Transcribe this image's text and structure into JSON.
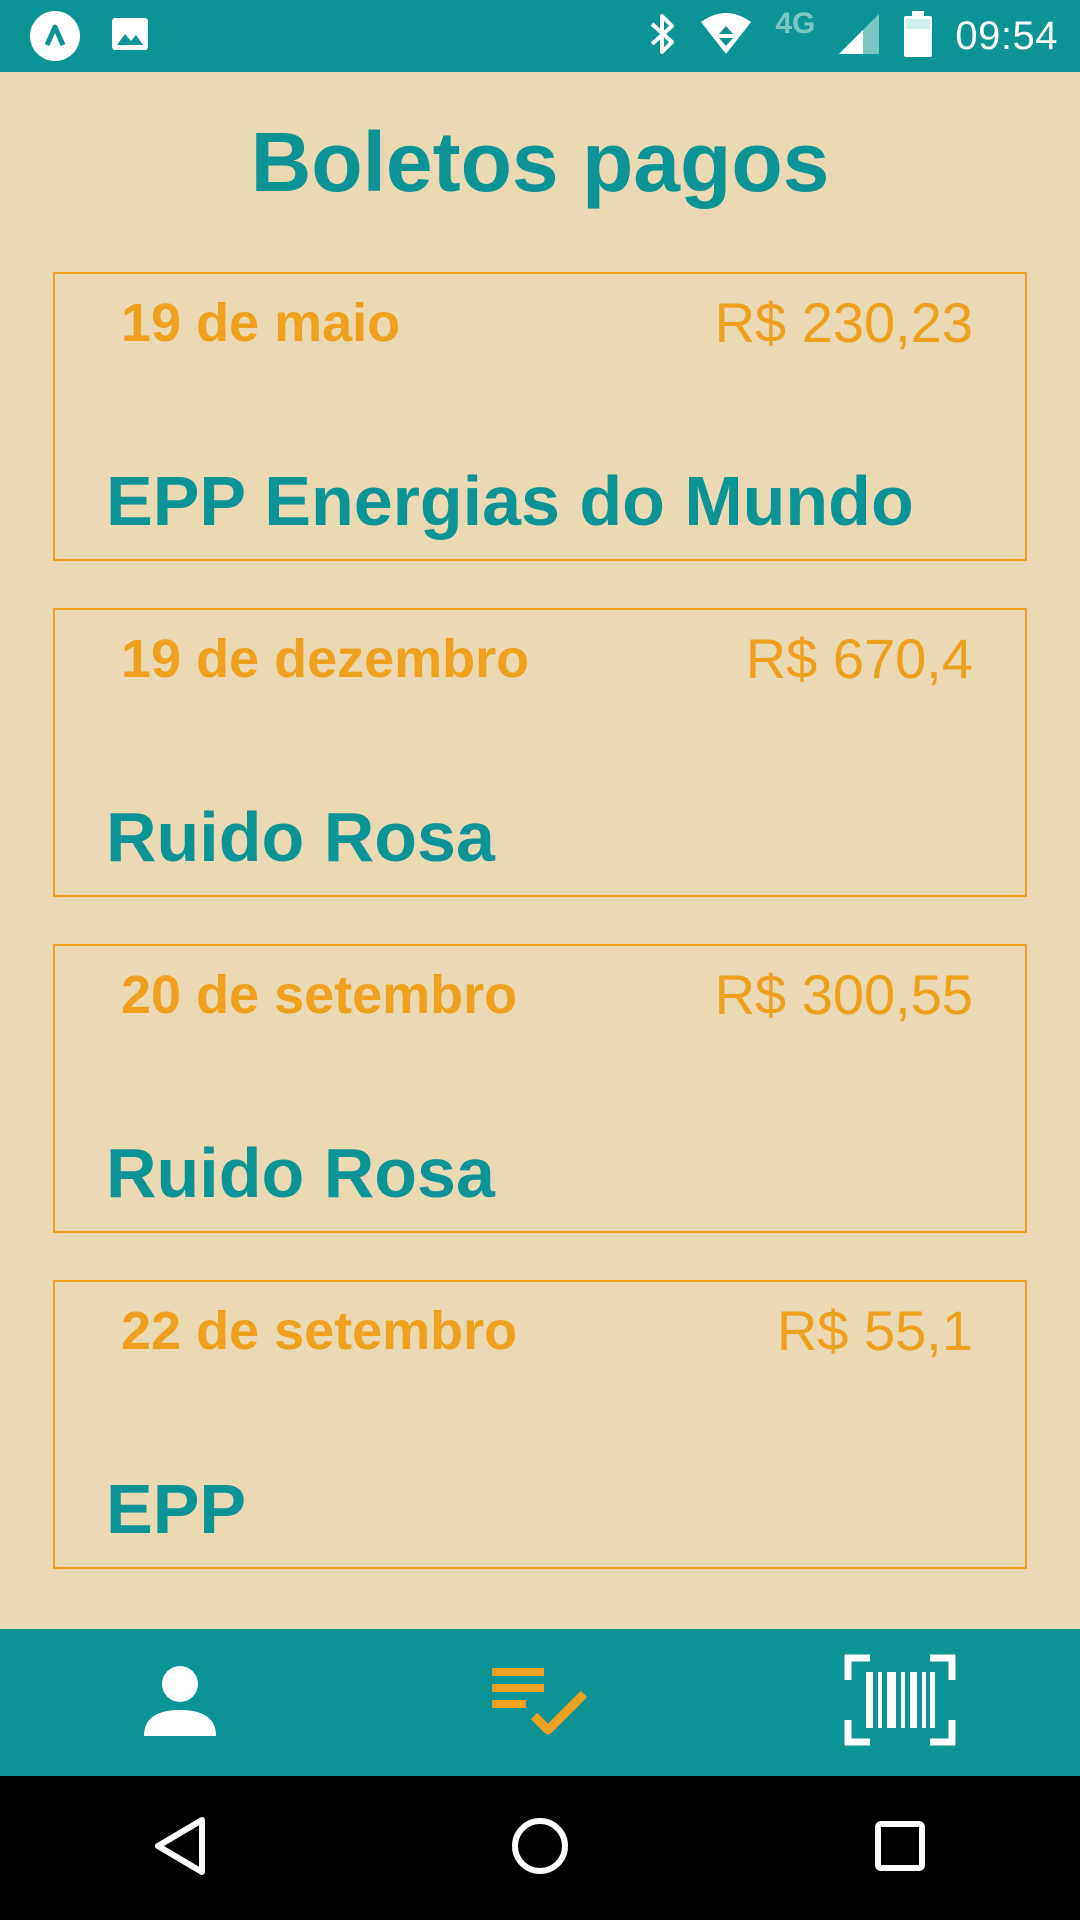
{
  "status_bar": {
    "time": "09:54",
    "network": "4G",
    "icons": [
      "app-icon",
      "image-icon",
      "bluetooth-icon",
      "wifi-icon",
      "signal-icon",
      "battery-icon"
    ]
  },
  "page": {
    "title": "Boletos pagos"
  },
  "payments": [
    {
      "date": "19 de maio",
      "amount": "R$ 230,23",
      "payee": "EPP Energias do Mundo"
    },
    {
      "date": "19 de dezembro",
      "amount": "R$ 670,4",
      "payee": "Ruido Rosa"
    },
    {
      "date": "20 de setembro",
      "amount": "R$ 300,55",
      "payee": "Ruido Rosa"
    },
    {
      "date": "22 de setembro",
      "amount": "R$ 55,1",
      "payee": "EPP"
    }
  ],
  "bottom_nav": {
    "items": [
      {
        "icon": "person-icon",
        "active": false
      },
      {
        "icon": "playlist-check-icon",
        "active": true
      },
      {
        "icon": "barcode-scan-icon",
        "active": false
      }
    ]
  },
  "system_nav": [
    "back-icon",
    "home-icon",
    "recents-icon"
  ],
  "colors": {
    "teal": "#0B9395",
    "orange": "#EFA01E",
    "background": "#EAD9B2"
  }
}
